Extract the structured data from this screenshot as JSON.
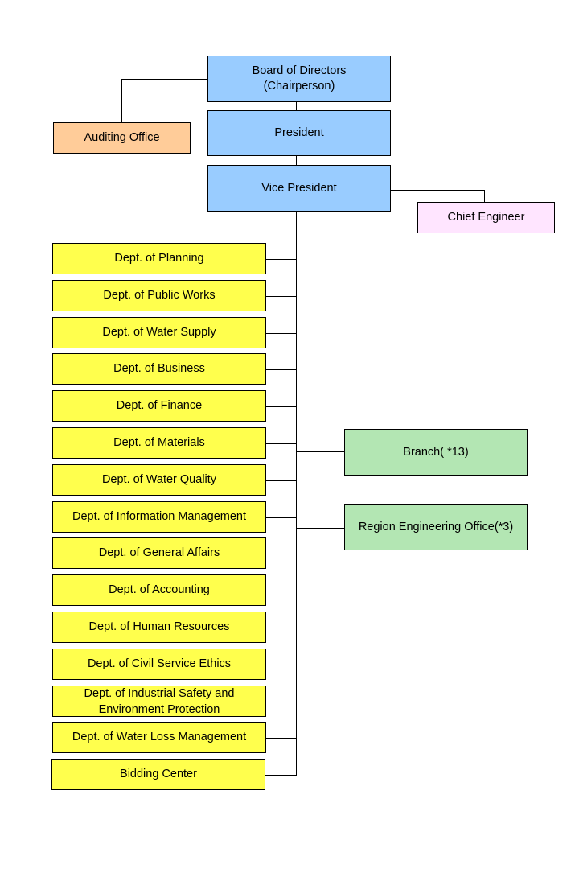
{
  "chart": {
    "top": {
      "board": "Board of Directors\n(Chairperson)",
      "president": "President",
      "vice_president": "Vice President",
      "auditing_office": "Auditing Office",
      "chief_engineer": "Chief Engineer"
    },
    "departments": [
      "Dept. of Planning",
      "Dept. of Public Works",
      "Dept. of Water Supply",
      "Dept. of Business",
      "Dept. of Finance",
      "Dept. of Materials",
      "Dept. of Water Quality",
      "Dept. of Information Management",
      "Dept. of General Affairs",
      "Dept. of Accounting",
      "Dept. of Human Resources",
      "Dept. of Civil Service Ethics",
      "Dept. of Industrial Safety and Environment Protection",
      "Dept. of Water Loss Management",
      "Bidding Center"
    ],
    "field_units": [
      "Branch( *13)",
      "Region Engineering Office(*3)"
    ]
  },
  "colors": {
    "executive": "#99ccff",
    "audit": "#ffcc99",
    "engineer": "#ffe5ff",
    "department": "#ffff4d",
    "field": "#b3e6b3"
  }
}
